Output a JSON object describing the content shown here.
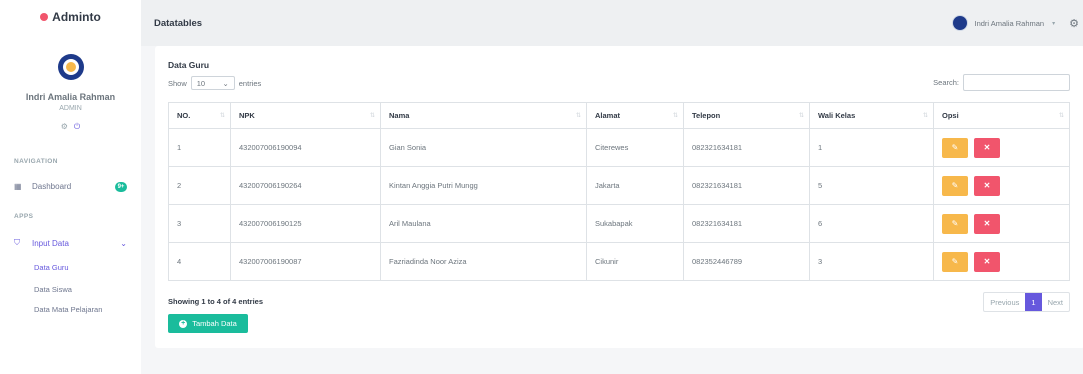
{
  "brand": {
    "name": "Adminto"
  },
  "user": {
    "name": "Indri Amalia Rahman",
    "role": "ADMIN"
  },
  "nav": {
    "section_navigation": "NAVIGATION",
    "dashboard_label": "Dashboard",
    "dashboard_badge": "9+",
    "section_apps": "APPS",
    "input_data_label": "Input Data",
    "sub_items": [
      "Data Guru",
      "Data Siswa",
      "Data Mata Pelajaran"
    ]
  },
  "topbar": {
    "title": "Datatables",
    "user_name": "Indri Amalia Rahman"
  },
  "card": {
    "title": "Data Guru",
    "show_label": "Show",
    "entries_value": "10",
    "entries_label": "entries",
    "search_label": "Search:",
    "search_value": "",
    "info": "Showing 1 to 4 of 4 entries",
    "add_button": "Tambah Data"
  },
  "table": {
    "columns": [
      "NO.",
      "NPK",
      "Nama",
      "Alamat",
      "Telepon",
      "Wali Kelas",
      "Opsi"
    ],
    "rows": [
      [
        "1",
        "432007006190094",
        "Gian Sonia",
        "Citerewes",
        "082321634181",
        "1"
      ],
      [
        "2",
        "432007006190264",
        "Kintan Anggia Putri Mungg",
        "Jakarta",
        "082321634181",
        "5"
      ],
      [
        "3",
        "432007006190125",
        "Aril Maulana",
        "Sukabapak",
        "082321634181",
        "6"
      ],
      [
        "4",
        "432007006190087",
        "Fazriadinda Noor Aziza",
        "Cikunir",
        "082352446789",
        "3"
      ]
    ]
  },
  "pagination": {
    "previous": "Previous",
    "current": "1",
    "next": "Next"
  },
  "colors": {
    "primary": "#6658dd",
    "success": "#1abc9c",
    "warning": "#f7b84b",
    "danger": "#f1556c"
  }
}
